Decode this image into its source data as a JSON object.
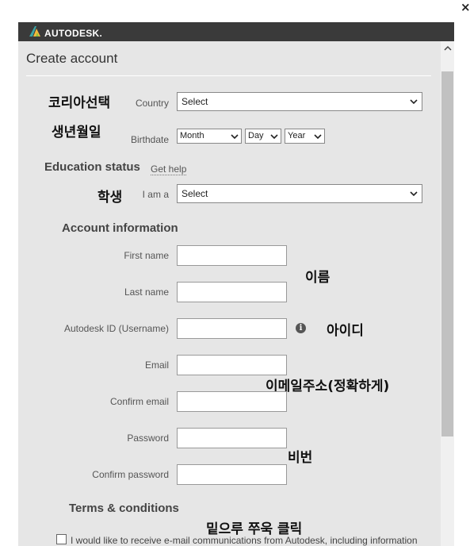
{
  "window": {
    "close_glyph": "×"
  },
  "brand": {
    "name": "AUTODESK."
  },
  "form": {
    "title": "Create account",
    "country": {
      "label": "Country",
      "value": "Select"
    },
    "birthdate": {
      "label": "Birthdate",
      "month": "Month",
      "day": "Day",
      "year": "Year"
    },
    "education": {
      "heading": "Education status",
      "help_link": "Get help",
      "label": "I am a",
      "value": "Select"
    },
    "account": {
      "heading": "Account information",
      "first_name_label": "First name",
      "last_name_label": "Last name",
      "username_label": "Autodesk ID (Username)",
      "email_label": "Email",
      "confirm_email_label": "Confirm email",
      "password_label": "Password",
      "confirm_password_label": "Confirm password"
    },
    "terms": {
      "heading": "Terms & conditions",
      "checkbox_label": "I would like to receive e-mail communications from Autodesk, including information"
    }
  },
  "annotations": {
    "country": "코리아선택",
    "birthdate": "생년월일",
    "student": "학생",
    "name": "이름",
    "id": "아이디",
    "email": "이메일주소(정확하게)",
    "password": "비번",
    "terms": "밑으루 쭈욱 클릭"
  },
  "colors": {
    "topbar": "#3a3a3a",
    "panel": "#e6e6e6",
    "logo_accent": "#3ca6a6"
  },
  "icons": [
    "autodesk-logo-icon",
    "info-icon",
    "chevron-down-icon",
    "scroll-up-icon",
    "close-icon"
  ]
}
